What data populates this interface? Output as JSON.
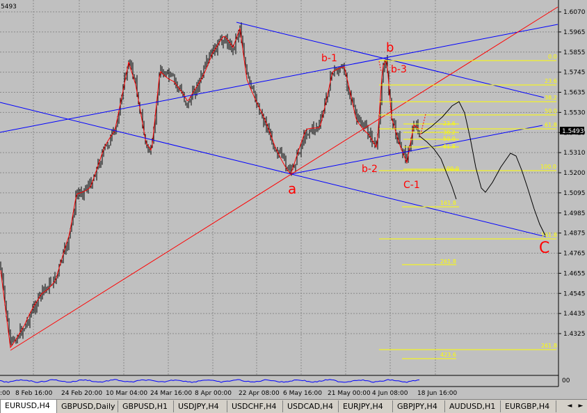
{
  "chart_data": {
    "type": "line",
    "symbol": "EURUSD",
    "timeframe": "H4",
    "corner_label": "5493",
    "current_price": "1.5493",
    "y_axis_ticks": [
      "1.6070",
      "1.5965",
      "1.5855",
      "1.5745",
      "1.5635",
      "1.5530",
      "1.5420",
      "1.5310",
      "1.5200",
      "1.5095",
      "1.4985",
      "1.4875",
      "1.4765",
      "1.4655",
      "1.4545",
      "1.4435",
      "1.4325"
    ],
    "ylim": [
      1.4325,
      1.607
    ],
    "x_axis_ticks": [
      ":00",
      "8 Feb 16:00",
      "24 Feb 20:00",
      "10 Mar 04:00",
      "24 Mar 16:00",
      "8 Apr 00:00",
      "22 Apr 08:00",
      "6 May 16:00",
      "21 May 00:00",
      "4 Jun 08:00",
      "18 Jun 16:00"
    ],
    "wave_labels": [
      {
        "text": "a",
        "color": "#ff0000"
      },
      {
        "text": "b",
        "color": "#ff0000"
      },
      {
        "text": "b-1",
        "color": "#ff0000"
      },
      {
        "text": "b-2",
        "color": "#ff0000"
      },
      {
        "text": "b-3",
        "color": "#ff0000"
      },
      {
        "text": "C-1",
        "color": "#ff0000"
      },
      {
        "text": "C",
        "color": "#ff0000"
      }
    ],
    "fib_labels": [
      "0.0",
      "23.6",
      "38.2",
      "50.0",
      "61.8",
      "100.0",
      "23.6",
      "38.2",
      "50.0",
      "61.8",
      "100.0",
      "161.8",
      "261.8",
      "161.8",
      "261.8",
      "423.6"
    ],
    "indicator_label": "00",
    "colors": {
      "background": "#c0c0c0",
      "candles": "#000000",
      "ma": "#ff0000",
      "channel": "#0000ff",
      "trend": "#ff0000",
      "fib": "#ffff00",
      "projection": "#000000"
    },
    "grid": true
  },
  "tabs": [
    {
      "label": "EURUSD,H4",
      "active": true
    },
    {
      "label": "GBPUSD,Daily",
      "active": false
    },
    {
      "label": "GBPUSD,H1",
      "active": false
    },
    {
      "label": "USDJPY,H4",
      "active": false
    },
    {
      "label": "USDCHF,H4",
      "active": false
    },
    {
      "label": "USDCAD,H4",
      "active": false
    },
    {
      "label": "EURJPY,H4",
      "active": false
    },
    {
      "label": "GBPJPY,H4",
      "active": false
    },
    {
      "label": "AUDUSD,H1",
      "active": false
    },
    {
      "label": "EURGBP,H4",
      "active": false
    }
  ],
  "nav": {
    "left": "◄",
    "right": "►"
  }
}
